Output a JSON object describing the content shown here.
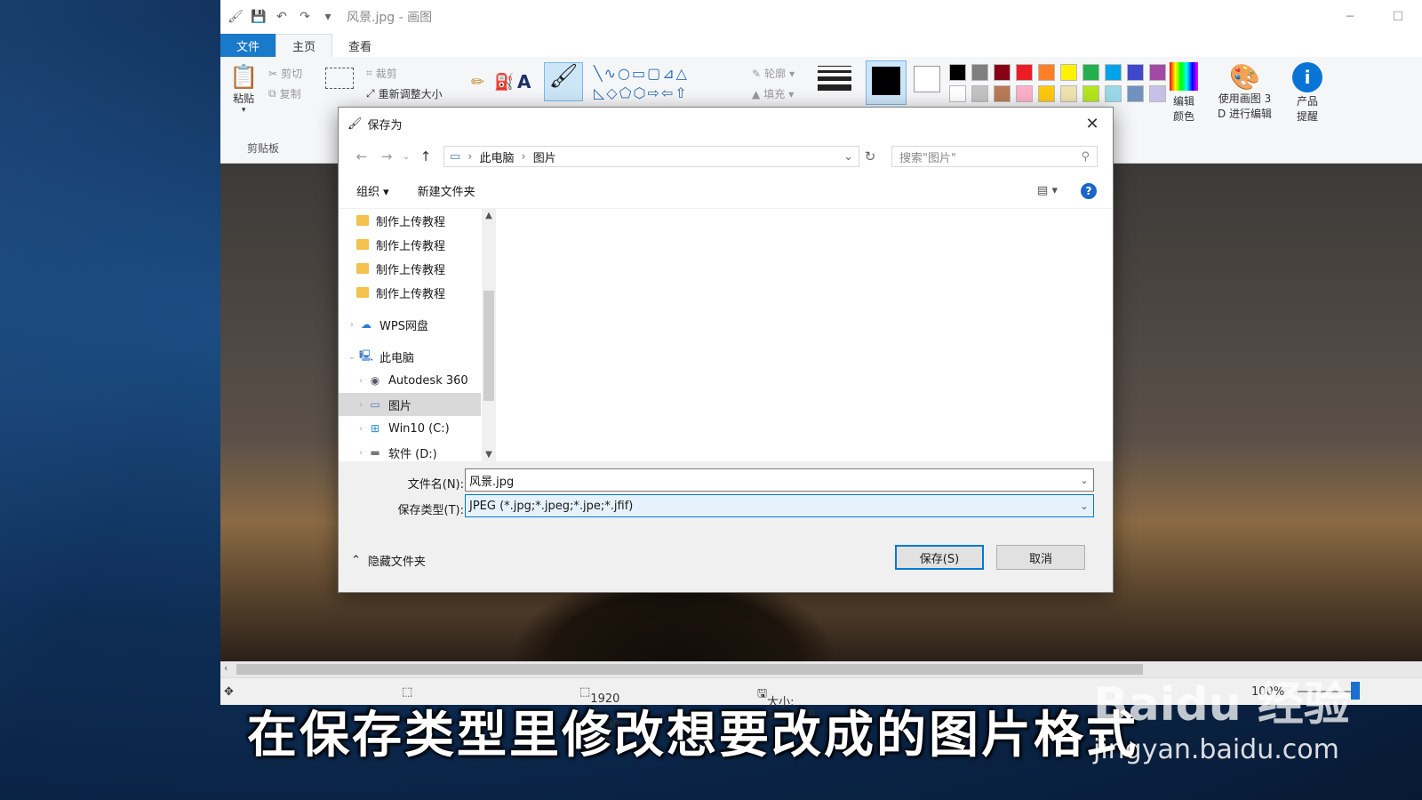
{
  "window": {
    "title": "风景.jpg - 画图",
    "minimize_glyph": "─",
    "maximize_glyph": "☐"
  },
  "tabs": [
    {
      "label": "文件"
    },
    {
      "label": "主页"
    },
    {
      "label": "查看"
    }
  ],
  "ribbon": {
    "paste_label": "粘贴",
    "cut_label": "剪切",
    "copy_label": "复制",
    "clipboard_group": "剪贴板",
    "crop_label": "裁剪",
    "resize_label": "重新调整大小",
    "outline_label": "轮廓",
    "fill_label": "填充",
    "edit_colors_label": "编辑\n颜色",
    "paint3d_label": "使用画图 3\nD 进行编辑",
    "product_alert_label": "产品\n提醒",
    "palette": [
      "#000000",
      "#7f7f7f",
      "#880015",
      "#ed1c24",
      "#ff7f27",
      "#fff200",
      "#22b14c",
      "#00a2e8",
      "#3f48cc",
      "#a349a4",
      "#ffffff",
      "#c3c3c3",
      "#b97a57",
      "#ffaec9",
      "#ffc90e",
      "#efe4b0",
      "#b5e61d",
      "#99d9ea",
      "#7092be",
      "#c8bfe7"
    ]
  },
  "statusbar": {
    "dimensions": "1920 × 1200像素",
    "size": "大小: 387.5KB",
    "zoom": "100%"
  },
  "dialog": {
    "title": "保存为",
    "breadcrumb": [
      "此电脑",
      "图片"
    ],
    "search_placeholder": "搜索\"图片\"",
    "organize_label": "组织 ▾",
    "new_folder_label": "新建文件夹",
    "help_label": "?",
    "nav_items": [
      {
        "label": "制作上传教程",
        "icon": "folder-icon"
      },
      {
        "label": "制作上传教程",
        "icon": "folder-icon"
      },
      {
        "label": "制作上传教程",
        "icon": "folder-icon"
      },
      {
        "label": "制作上传教程",
        "icon": "folder-icon"
      },
      {
        "label": "WPS网盘",
        "icon": "cloud-icon"
      },
      {
        "label": "此电脑",
        "icon": "computer-icon"
      },
      {
        "label": "Autodesk 360",
        "icon": "autodesk-icon"
      },
      {
        "label": "图片",
        "icon": "pictures-icon"
      },
      {
        "label": "Win10 (C:)",
        "icon": "drive-icon"
      },
      {
        "label": "软件 (D:)",
        "icon": "drive-icon"
      }
    ],
    "filename_label": "文件名(N):",
    "filename_value": "风景.jpg",
    "filetype_label": "保存类型(T):",
    "filetype_value": "JPEG (*.jpg;*.jpeg;*.jpe;*.jfif)",
    "hide_folders_label": "隐藏文件夹",
    "save_label": "保存(S)",
    "cancel_label": "取消"
  },
  "overlay": {
    "caption": "在保存类型里修改想要改成的图片格式",
    "watermark": "Baidu 经验",
    "watermark_url": "jingyan.baidu.com"
  }
}
